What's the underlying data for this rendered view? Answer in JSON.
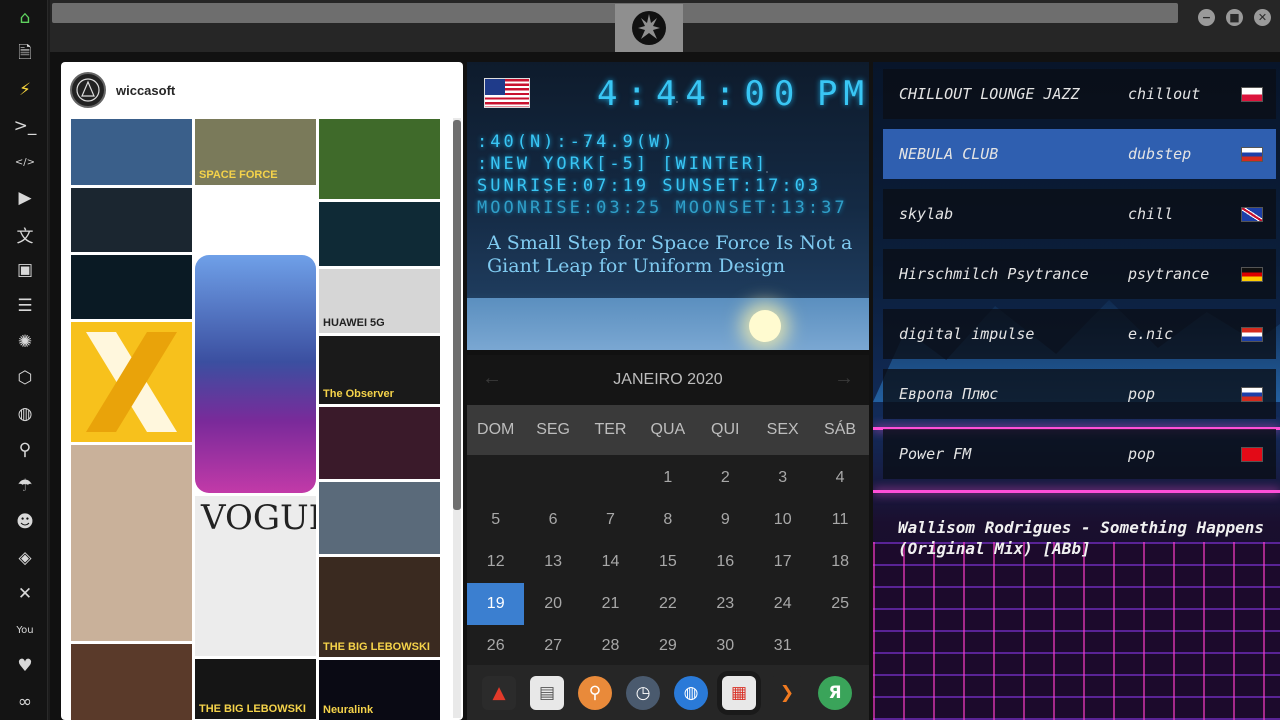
{
  "sidebar": {
    "items": [
      {
        "icon": "home-icon",
        "glyph": "⌂"
      },
      {
        "icon": "document-icon",
        "glyph": "🗎"
      },
      {
        "icon": "bolt-icon",
        "glyph": "⚡"
      },
      {
        "icon": "terminal-icon",
        "glyph": ">_"
      },
      {
        "icon": "code-icon",
        "glyph": "</>"
      },
      {
        "icon": "play-icon",
        "glyph": "▶"
      },
      {
        "icon": "translate-icon",
        "glyph": "文"
      },
      {
        "icon": "image-icon",
        "glyph": "▣"
      },
      {
        "icon": "news-icon",
        "glyph": "☰"
      },
      {
        "icon": "rebel-icon",
        "glyph": "✺"
      },
      {
        "icon": "hexagon-icon",
        "glyph": "⬡"
      },
      {
        "icon": "globe-icon",
        "glyph": "◍"
      },
      {
        "icon": "search-icon",
        "glyph": "⚲"
      },
      {
        "icon": "umbrella-icon",
        "glyph": "☂"
      },
      {
        "icon": "contact-icon",
        "glyph": "☻"
      },
      {
        "icon": "tag-icon",
        "glyph": "◈"
      },
      {
        "icon": "tools-icon",
        "glyph": "✕"
      },
      {
        "icon": "youtube-icon",
        "glyph": "You"
      },
      {
        "icon": "heart-icon",
        "glyph": "♥"
      },
      {
        "icon": "infinity-icon",
        "glyph": "∞"
      }
    ]
  },
  "window": {
    "minimize": "−",
    "maximize": "■",
    "close": "✕"
  },
  "instagram": {
    "username": "wiccasoft",
    "tiles": [
      {
        "name": "startrek-tile",
        "color": "#3a5f8a"
      },
      {
        "name": "spaceforce-tile",
        "color": "#7a7a5a",
        "text": "SPACE FORCE"
      },
      {
        "name": "football-tile",
        "color": "#3f6a2a"
      },
      {
        "name": "tron-people-tile",
        "color": "#1b2630"
      },
      {
        "name": "diagram-tile",
        "color": "#ffffff"
      },
      {
        "name": "tron-stage-tile",
        "color": "#0f2a36"
      },
      {
        "name": "tron-bike-tile",
        "color": "#0a1a24"
      },
      {
        "name": "phone-case-tile",
        "color": "#3b4f9a"
      },
      {
        "name": "huawei-5g-tile",
        "color": "#d6d6d6",
        "text": "HUAWEI 5G"
      },
      {
        "name": "observer-tile",
        "color": "#1a1a1a",
        "text": "The Observer"
      },
      {
        "name": "x-logo-tile",
        "color": "#f7c11c"
      },
      {
        "name": "tv-tile",
        "color": "#3a1a2a"
      },
      {
        "name": "bank-tile",
        "color": "#5a6a7a"
      },
      {
        "name": "gisele-tile",
        "color": "#c9b19a"
      },
      {
        "name": "vogue-tile",
        "color": "#ececec",
        "text": "VOGUE"
      },
      {
        "name": "lebowski-tile",
        "color": "#3a2a20",
        "text": "THE BIG LEBOWSKI"
      },
      {
        "name": "album-tile",
        "color": "#5a3a2a"
      },
      {
        "name": "lebowski-2-tile",
        "color": "#151515",
        "text": "THE BIG LEBOWSKI"
      },
      {
        "name": "neuralink-tile",
        "color": "#0a0a14",
        "text": "Neuralink"
      }
    ]
  },
  "clock": {
    "time": "4:44:00",
    "ampm": "PM",
    "coords": ":40(N):-74.9(W)",
    "city": ":NEW YORK[-5] [WINTER]",
    "sun": "SUNRISE:07:19 SUNSET:17:03",
    "moon": "MOONRISE:03:25 MOONSET:13:37",
    "headline": "A Small Step for Space Force Is Not a Giant Leap for Uniform Design"
  },
  "calendar": {
    "month": "JANEIRO 2020",
    "prev": "←",
    "next": "→",
    "weekdays": [
      "DOM",
      "SEG",
      "TER",
      "QUA",
      "QUI",
      "SEX",
      "SÁB"
    ],
    "days": [
      [
        "",
        "",
        "",
        "1",
        "2",
        "3",
        "4"
      ],
      [
        "5",
        "6",
        "7",
        "8",
        "9",
        "10",
        "11"
      ],
      [
        "12",
        "13",
        "14",
        "15",
        "16",
        "17",
        "18"
      ],
      [
        "19",
        "20",
        "21",
        "22",
        "23",
        "24",
        "25"
      ],
      [
        "26",
        "27",
        "28",
        "29",
        "30",
        "31",
        ""
      ]
    ],
    "today": "19"
  },
  "dock": [
    {
      "icon": "anydesk-icon",
      "bg": "#2b2b2b",
      "fg": "#e23a2a",
      "glyph": "▲"
    },
    {
      "icon": "newspaper-icon",
      "bg": "#e8e8e8",
      "fg": "#555",
      "glyph": "▤"
    },
    {
      "icon": "magnifier-icon",
      "bg": "#e98a3a",
      "fg": "#fff",
      "glyph": "⚲"
    },
    {
      "icon": "clock-icon",
      "bg": "#4a5a6e",
      "fg": "#fff",
      "glyph": "◷"
    },
    {
      "icon": "globe-icon",
      "bg": "#2a7ad8",
      "fg": "#fff",
      "glyph": "◍"
    },
    {
      "icon": "calendar-icon",
      "bg": "#e8e8e8",
      "fg": "#d93025",
      "glyph": "▦"
    },
    {
      "icon": "arrow-icon",
      "bg": "#262626",
      "fg": "#f07a20",
      "glyph": "❯"
    },
    {
      "icon": "yandex-icon",
      "bg": "#3aa45a",
      "fg": "#fff",
      "glyph": "Я"
    }
  ],
  "radio": {
    "stations": [
      {
        "name": "CHILLOUT LOUNGE JAZZ",
        "genre": "chillout",
        "flag": "poland"
      },
      {
        "name": "NEBULA CLUB",
        "genre": "dubstep",
        "flag": "russia"
      },
      {
        "name": "skylab",
        "genre": "chill",
        "flag": "uk"
      },
      {
        "name": "Hirschmilch Psytrance",
        "genre": "psytrance",
        "flag": "germany"
      },
      {
        "name": "digital impulse",
        "genre": "e.nic",
        "flag": "croatia"
      },
      {
        "name": "Европа Плюс",
        "genre": "pop",
        "flag": "russia"
      },
      {
        "name": "Power FM",
        "genre": "pop",
        "flag": "turkey"
      }
    ],
    "selected": 1,
    "now_playing": "Wallisom Rodrigues - Something Happens (Original Mix) [ABb]"
  }
}
